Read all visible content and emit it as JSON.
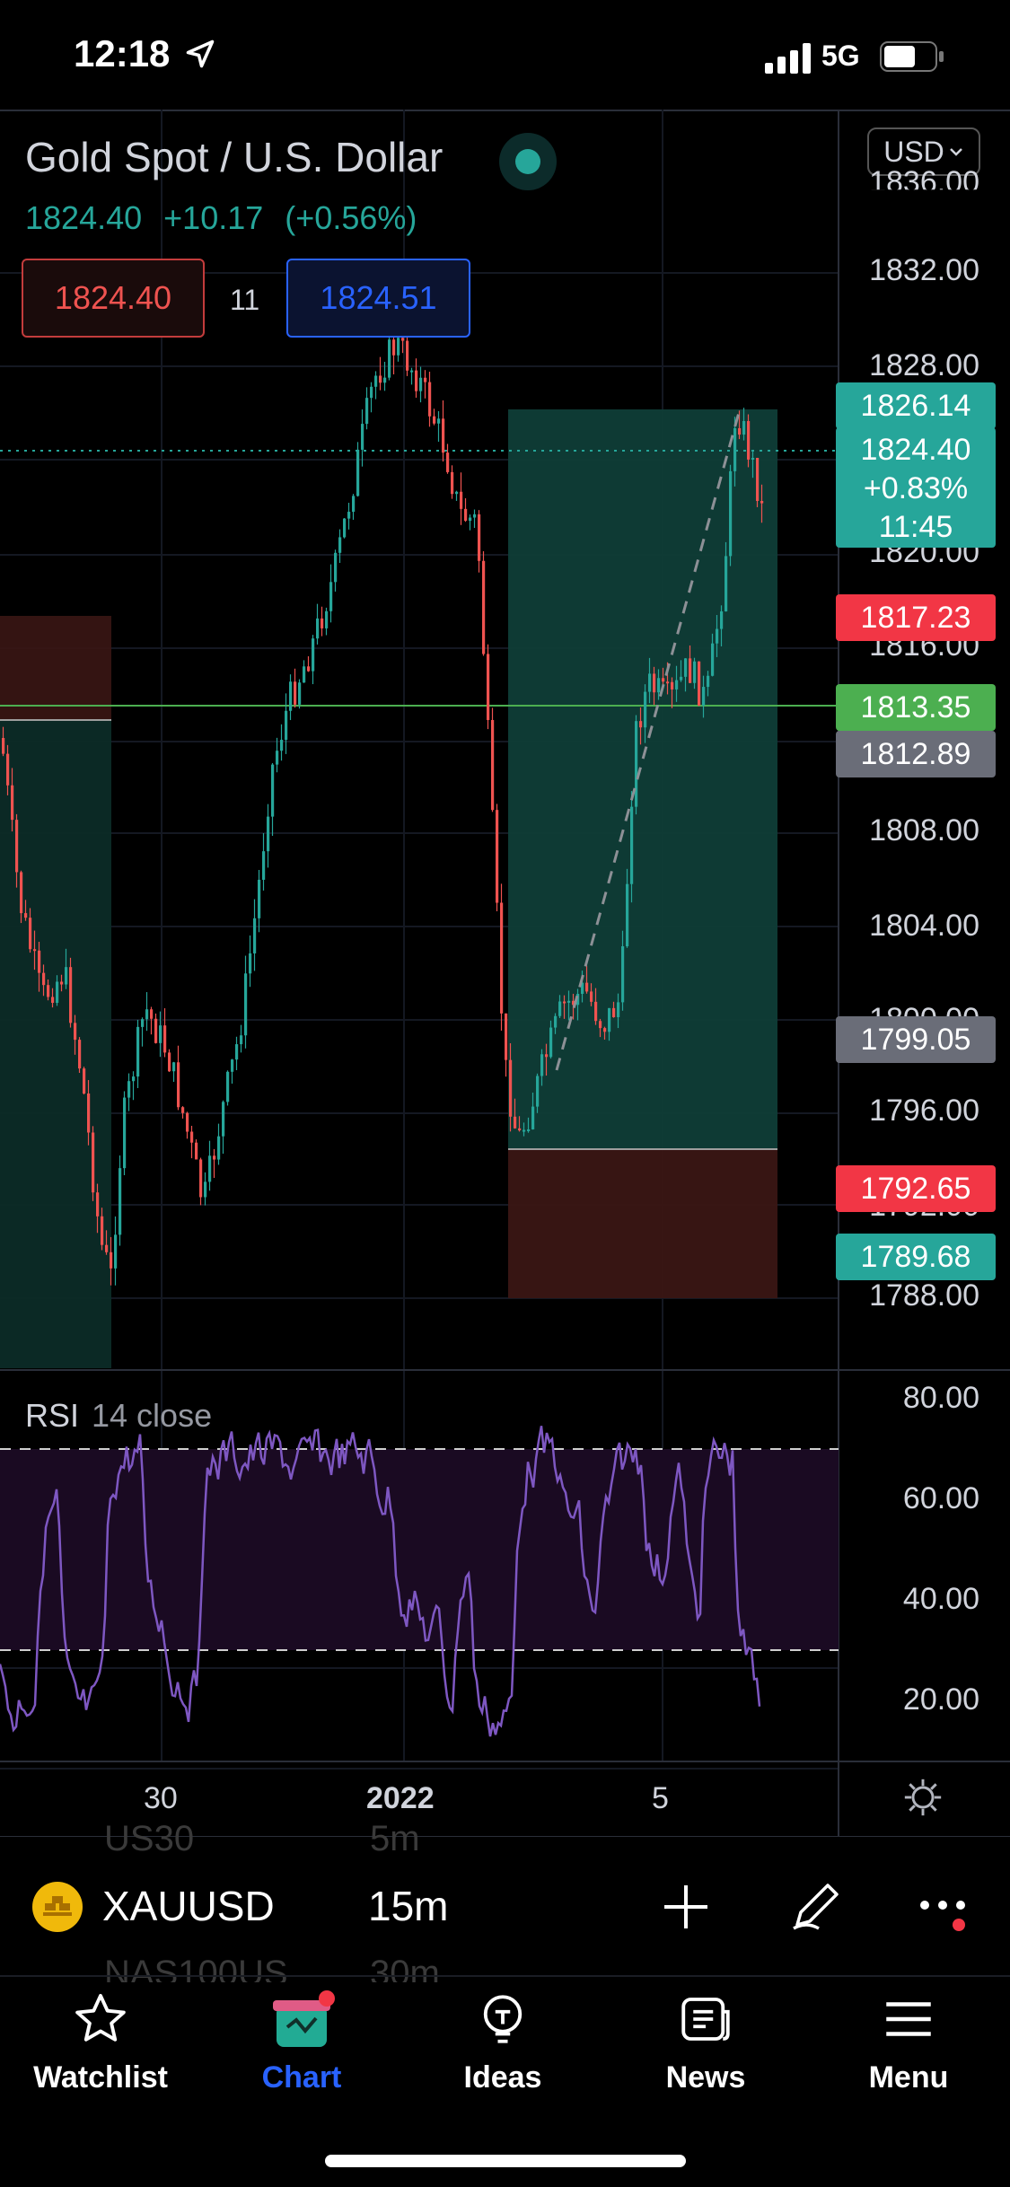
{
  "status_bar": {
    "time": "12:18",
    "network": "5G"
  },
  "header": {
    "symbol_title": "Gold Spot / U.S. Dollar",
    "last_price": "1824.40",
    "change": "+10.17",
    "change_pct": "(+0.56%)",
    "bid": "1824.40",
    "spread": "11",
    "ask": "1824.51",
    "currency": "USD"
  },
  "price_axis": {
    "labels": [
      "1832.00",
      "1828.00",
      "1820.00",
      "1816.00",
      "1808.00",
      "1804.00",
      "1796.00",
      "1788.00"
    ],
    "partial_labels": [
      "1836.00",
      "1800.00",
      "1792.00"
    ]
  },
  "price_tags": {
    "target": "1826.14",
    "current_price": "1824.40",
    "current_change": "+0.83%",
    "countdown": "11:45",
    "red_level": "1817.23",
    "green_level": "1813.35",
    "gray_level": "1812.89",
    "entry_level": "1799.05",
    "stop_level": "1792.65",
    "low_level": "1789.68"
  },
  "rsi": {
    "name": "RSI",
    "params": "14 close",
    "axis_labels": [
      "80.00",
      "60.00",
      "40.00",
      "20.00"
    ]
  },
  "time_axis": {
    "labels": [
      "30",
      "2022",
      "5"
    ]
  },
  "symbol_bar": {
    "symbol": "XAUUSD",
    "interval": "15m",
    "ghost_above": [
      "US30",
      "5m"
    ],
    "ghost_below": [
      "NAS100US",
      "30m"
    ]
  },
  "tabs": [
    {
      "label": "Watchlist",
      "icon": "star-icon"
    },
    {
      "label": "Chart",
      "icon": "chart-gift-icon",
      "active": true
    },
    {
      "label": "Ideas",
      "icon": "lightbulb-icon"
    },
    {
      "label": "News",
      "icon": "newspaper-icon"
    },
    {
      "label": "Menu",
      "icon": "hamburger-icon"
    }
  ],
  "colors": {
    "up": "#26a69a",
    "down": "#ef5350",
    "accent": "#2962ff",
    "rsi": "#7e57c2",
    "green_line": "#4caf50"
  }
}
